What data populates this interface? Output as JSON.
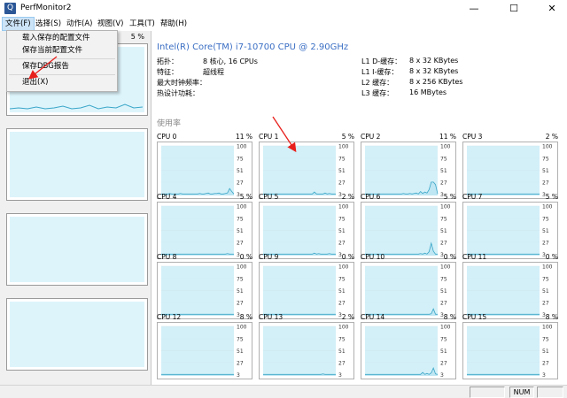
{
  "window": {
    "title": "PerfMonitor2",
    "minimize": "—",
    "maximize": "☐",
    "close": "✕"
  },
  "menu": [
    "文件(F)",
    "选择(S)",
    "动作(A)",
    "视图(V)",
    "工具(T)",
    "帮助(H)"
  ],
  "file_menu": [
    "载入保存的配置文件",
    "保存当前配置文件",
    "保存DBG报告",
    "退出(X)"
  ],
  "sidebar": {
    "thumb1_pct": "5 %",
    "thumbnails": 4
  },
  "cpu": {
    "title": "Intel(R) Core(TM) i7-10700 CPU @ 2.90GHz",
    "left_specs": [
      {
        "label": "拓扑：",
        "value": "8 核心, 16 CPUs"
      },
      {
        "label": "特征：",
        "value": "超线程"
      },
      {
        "label": "最大时钟频率：",
        "value": ""
      },
      {
        "label": "热设计功耗：",
        "value": ""
      }
    ],
    "right_specs": [
      {
        "label": "L1 D-缓存：",
        "value": "8 x 32 KBytes"
      },
      {
        "label": "L1 I-缓存：",
        "value": "8 x 32 KBytes"
      },
      {
        "label": "L2 缓存：",
        "value": "8 x 256 KBytes"
      },
      {
        "label": "L3 缓存：",
        "value": "16 MBytes"
      }
    ]
  },
  "usage_label": "使用率",
  "axis_ticks": [
    "100",
    "75",
    "51",
    "27",
    "3"
  ],
  "cpus": [
    {
      "name": "CPU 0",
      "pct": "11 %",
      "series": [
        3,
        3,
        3,
        3,
        4,
        3,
        3,
        3,
        3,
        4,
        3,
        3,
        3,
        3,
        3,
        3,
        3,
        3,
        4,
        3,
        3,
        4,
        5,
        3,
        3,
        4,
        4,
        5,
        3,
        3,
        4,
        5,
        14,
        8,
        3
      ]
    },
    {
      "name": "CPU 1",
      "pct": "5 %",
      "series": [
        3,
        3,
        3,
        3,
        3,
        3,
        3,
        3,
        3,
        3,
        3,
        3,
        3,
        3,
        3,
        3,
        3,
        3,
        3,
        3,
        3,
        3,
        3,
        3,
        7,
        3,
        3,
        3,
        3,
        5,
        3,
        4,
        3,
        3,
        3
      ]
    },
    {
      "name": "CPU 2",
      "pct": "11 %",
      "series": [
        3,
        3,
        3,
        3,
        3,
        3,
        3,
        3,
        3,
        3,
        3,
        3,
        3,
        3,
        3,
        3,
        3,
        3,
        4,
        3,
        3,
        4,
        3,
        4,
        5,
        3,
        8,
        4,
        7,
        5,
        12,
        27,
        27,
        22,
        3
      ]
    },
    {
      "name": "CPU 3",
      "pct": "2 %",
      "series": [
        3,
        3,
        3,
        3,
        3,
        3,
        3,
        3,
        3,
        3,
        3,
        3,
        3,
        3,
        3,
        3,
        3,
        3,
        3,
        3,
        3,
        3,
        3,
        3,
        3,
        3,
        3,
        3,
        3,
        3,
        3,
        3,
        3,
        3,
        3
      ]
    },
    {
      "name": "CPU 4",
      "pct": "5 %",
      "series": [
        3,
        3,
        3,
        3,
        3,
        3,
        3,
        3,
        3,
        3,
        3,
        3,
        3,
        3,
        3,
        3,
        3,
        3,
        3,
        3,
        3,
        3,
        3,
        3,
        3,
        3,
        3,
        3,
        3,
        3,
        3,
        4,
        3,
        3,
        3
      ]
    },
    {
      "name": "CPU 5",
      "pct": "2 %",
      "series": [
        3,
        3,
        3,
        3,
        3,
        3,
        3,
        3,
        3,
        3,
        3,
        3,
        3,
        3,
        3,
        3,
        3,
        3,
        3,
        3,
        3,
        3,
        3,
        3,
        5,
        3,
        4,
        3,
        3,
        3,
        3,
        4,
        3,
        3,
        3
      ]
    },
    {
      "name": "CPU 6",
      "pct": "5 %",
      "series": [
        3,
        3,
        3,
        3,
        3,
        3,
        3,
        3,
        3,
        3,
        3,
        3,
        3,
        3,
        3,
        3,
        3,
        3,
        3,
        3,
        3,
        3,
        3,
        3,
        3,
        3,
        4,
        3,
        5,
        3,
        8,
        25,
        9,
        3,
        3
      ]
    },
    {
      "name": "CPU 7",
      "pct": "5 %",
      "series": [
        3,
        3,
        3,
        3,
        3,
        3,
        3,
        3,
        3,
        3,
        3,
        3,
        3,
        3,
        3,
        3,
        3,
        3,
        3,
        3,
        3,
        3,
        3,
        3,
        3,
        3,
        3,
        3,
        3,
        3,
        3,
        3,
        3,
        3,
        3
      ]
    },
    {
      "name": "CPU 8",
      "pct": "0 %",
      "series": [
        3,
        3,
        3,
        3,
        3,
        3,
        3,
        3,
        3,
        3,
        3,
        3,
        3,
        3,
        3,
        3,
        3,
        3,
        3,
        3,
        3,
        3,
        3,
        3,
        3,
        3,
        3,
        3,
        3,
        3,
        3,
        3,
        3,
        3,
        3
      ]
    },
    {
      "name": "CPU 9",
      "pct": "0 %",
      "series": [
        3,
        3,
        3,
        3,
        3,
        3,
        3,
        3,
        3,
        3,
        3,
        3,
        3,
        3,
        3,
        3,
        3,
        3,
        3,
        3,
        3,
        3,
        3,
        3,
        3,
        3,
        3,
        3,
        3,
        3,
        3,
        3,
        3,
        3,
        3
      ]
    },
    {
      "name": "CPU 10",
      "pct": "0 %",
      "series": [
        3,
        3,
        3,
        3,
        3,
        3,
        3,
        3,
        3,
        3,
        3,
        3,
        3,
        3,
        3,
        3,
        3,
        3,
        3,
        3,
        3,
        3,
        3,
        3,
        3,
        3,
        3,
        3,
        3,
        3,
        3,
        4,
        14,
        3,
        3
      ]
    },
    {
      "name": "CPU 11",
      "pct": "0 %",
      "series": [
        3,
        3,
        3,
        3,
        3,
        3,
        3,
        3,
        3,
        3,
        3,
        3,
        3,
        3,
        3,
        3,
        3,
        3,
        3,
        3,
        3,
        3,
        3,
        3,
        3,
        3,
        3,
        3,
        3,
        3,
        3,
        3,
        3,
        3,
        3
      ]
    },
    {
      "name": "CPU 12",
      "pct": "8 %",
      "series": [
        3,
        3,
        3,
        3,
        3,
        3,
        3,
        3,
        3,
        3,
        3,
        3,
        3,
        3,
        3,
        3,
        3,
        3,
        3,
        3,
        3,
        3,
        3,
        3,
        3,
        3,
        3,
        3,
        3,
        3,
        3,
        3,
        3,
        3,
        3
      ]
    },
    {
      "name": "CPU 13",
      "pct": "2 %",
      "series": [
        3,
        3,
        3,
        3,
        3,
        3,
        3,
        3,
        3,
        3,
        3,
        3,
        3,
        3,
        3,
        3,
        3,
        3,
        3,
        3,
        3,
        3,
        3,
        3,
        3,
        3,
        3,
        3,
        4,
        3,
        3,
        3,
        3,
        3,
        3
      ]
    },
    {
      "name": "CPU 14",
      "pct": "8 %",
      "series": [
        3,
        3,
        3,
        3,
        3,
        3,
        3,
        3,
        3,
        3,
        3,
        3,
        3,
        3,
        3,
        3,
        3,
        3,
        3,
        3,
        3,
        3,
        3,
        3,
        3,
        3,
        3,
        7,
        3,
        5,
        3,
        6,
        16,
        4,
        3
      ]
    },
    {
      "name": "CPU 15",
      "pct": "8 %",
      "series": [
        3,
        3,
        3,
        3,
        3,
        3,
        3,
        3,
        3,
        3,
        3,
        3,
        3,
        3,
        3,
        3,
        3,
        3,
        3,
        3,
        3,
        3,
        3,
        3,
        3,
        3,
        3,
        3,
        3,
        3,
        3,
        3,
        3,
        3,
        3
      ]
    }
  ],
  "status": {
    "num": "NUM"
  },
  "colors": {
    "graph_fill": "#d3f0f8",
    "graph_line": "#3aa6c8",
    "grid": "#d0e8f0",
    "accent": "#3b6fc4",
    "arrow": "#e8201c"
  }
}
